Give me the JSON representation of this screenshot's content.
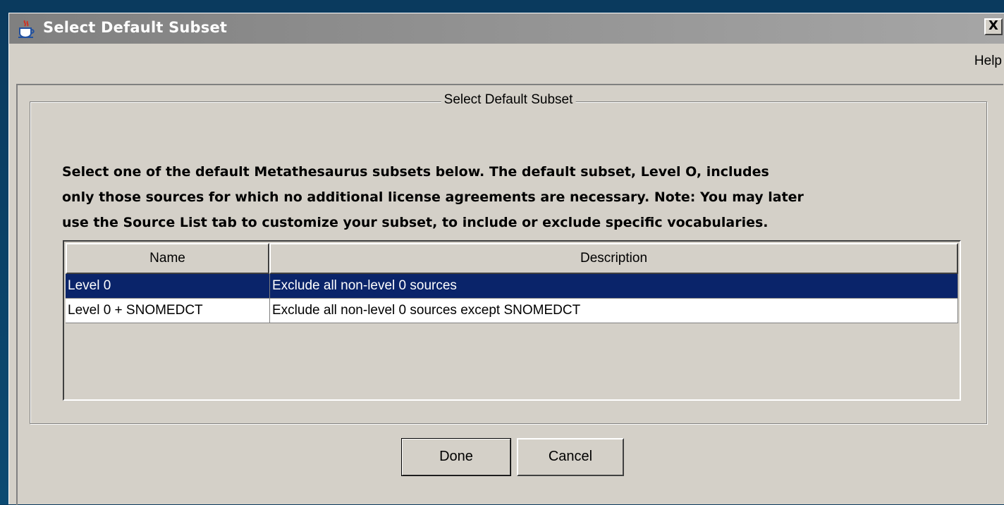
{
  "window": {
    "title": "Select Default Subset",
    "close_label": "X"
  },
  "menu": {
    "items": [
      "Help"
    ]
  },
  "group": {
    "title": "Select Default Subset"
  },
  "instructions": {
    "lines": [
      "Select one of the default Metathesaurus subsets below. The default subset, Level O, includes",
      "only those sources for which no additional license agreements are necessary. Note: You may later",
      "use the Source List tab to customize your subset, to include or exclude specific vocabularies."
    ]
  },
  "table": {
    "columns": [
      "Name",
      "Description"
    ],
    "rows": [
      {
        "name": "Level 0",
        "description": "Exclude all non-level 0 sources",
        "selected": true
      },
      {
        "name": "Level 0 + SNOMEDCT",
        "description": "Exclude all non-level 0 sources except SNOMEDCT",
        "selected": false
      }
    ]
  },
  "buttons": {
    "done": "Done",
    "cancel": "Cancel"
  },
  "colors": {
    "selection": "#0a246a",
    "dialog_bg": "#d4d0c8"
  },
  "icons": {
    "title_icon": "java-coffee-cup-icon"
  }
}
